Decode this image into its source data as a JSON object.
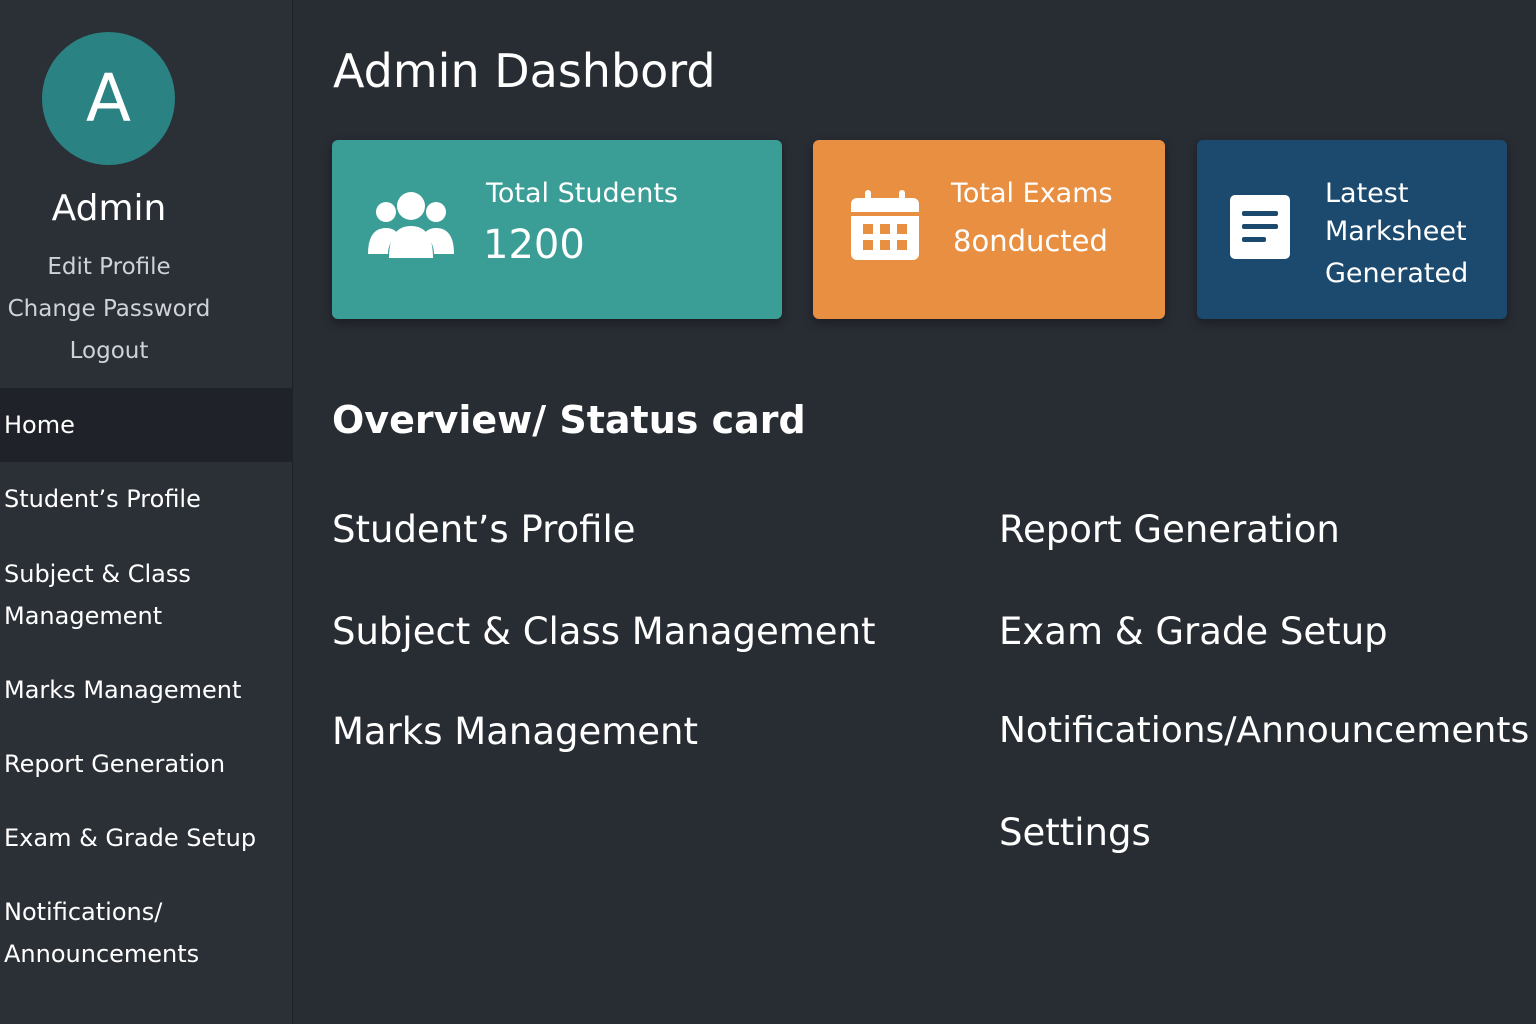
{
  "sidebar": {
    "avatar_letter": "A",
    "admin_name": "Admin",
    "profile_links": [
      "Edit Profile",
      "Change Password",
      "Logout"
    ],
    "nav": [
      {
        "label": "Home",
        "active": true
      },
      {
        "label": "Student’s Profile"
      },
      {
        "label": "Subject & Class",
        "label2": "Management"
      },
      {
        "label": "Marks Management"
      },
      {
        "label": "Report Generation"
      },
      {
        "label": "Exam & Grade Setup"
      },
      {
        "label": "Notifications/",
        "label2": "Announcements"
      }
    ]
  },
  "main": {
    "title": "Admin Dashbord",
    "cards": [
      {
        "title": "Total Students",
        "value": "1200",
        "icon": "users-icon",
        "color": "#3a9d96"
      },
      {
        "title": "Total Exams",
        "value": "8onducted",
        "icon": "calendar-icon",
        "color": "#e98f42"
      },
      {
        "line1": "Latest",
        "line2": "Marksheet",
        "line3": "Generated",
        "icon": "document-icon",
        "color": "#1b4a6e"
      }
    ],
    "section_title": "Overview/ Status card",
    "links_left": [
      "Student’s Profile",
      "Subject & Class Management",
      "Marks Management"
    ],
    "links_right": [
      "Report Generation",
      "Exam & Grade Setup",
      "Notifications/Announcements",
      "Settings"
    ]
  }
}
